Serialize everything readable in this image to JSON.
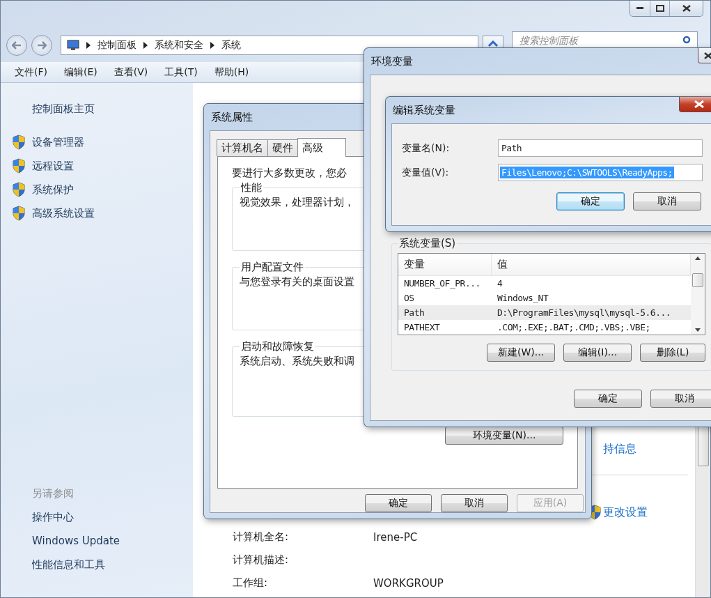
{
  "explorer": {
    "breadcrumb": [
      "控制面板",
      "系统和安全",
      "系统"
    ],
    "search": {
      "placeholder": "搜索控制面板"
    },
    "menu": [
      "文件(F)",
      "编辑(E)",
      "查看(V)",
      "工具(T)",
      "帮助(H)"
    ],
    "sidebar": {
      "home": "控制面板主页",
      "tasks": [
        "设备管理器",
        "远程设置",
        "系统保护",
        "高级系统设置"
      ],
      "see_also_title": "另请参阅",
      "see_also": [
        "操作中心",
        "Windows Update",
        "性能信息和工具"
      ]
    },
    "details": {
      "support_link": "持信息",
      "change_link": "更改设置",
      "rows": [
        {
          "label": "计算机全名:",
          "value": "Irene-PC"
        },
        {
          "label": "计算机描述:",
          "value": ""
        },
        {
          "label": "工作组:",
          "value": "WORKGROUP"
        }
      ]
    }
  },
  "system_properties": {
    "title": "系统属性",
    "tabs": [
      {
        "label": "计算机名",
        "selected": false
      },
      {
        "label": "硬件",
        "selected": false
      },
      {
        "label": "高级",
        "selected": true
      }
    ],
    "intro": "要进行大多数更改，您必",
    "groups": [
      {
        "title": "性能",
        "text": "视觉效果，处理器计划，"
      },
      {
        "title": "用户配置文件",
        "text": "与您登录有关的桌面设置"
      },
      {
        "title": "启动和故障恢复",
        "text": "系统启动、系统失败和调"
      }
    ],
    "env_button": "环境变量(N)...",
    "buttons": [
      {
        "label": "确定",
        "disabled": false
      },
      {
        "label": "取消",
        "disabled": false
      },
      {
        "label": "应用(A)",
        "disabled": true
      }
    ]
  },
  "env_vars": {
    "title": "环境变量",
    "system_group": "系统变量(S)",
    "columns": [
      "变量",
      "值"
    ],
    "rows": [
      {
        "name": "NUMBER_OF_PR...",
        "value": "4",
        "selected": false
      },
      {
        "name": "OS",
        "value": "Windows_NT",
        "selected": false
      },
      {
        "name": "Path",
        "value": "D:\\ProgramFiles\\mysql\\mysql-5.6...",
        "selected": true
      },
      {
        "name": "PATHEXT",
        "value": ".COM;.EXE;.BAT;.CMD;.VBS;.VBE;",
        "selected": false
      }
    ],
    "row_buttons": [
      "新建(W)...",
      "编辑(I)...",
      "删除(L)"
    ],
    "buttons": [
      "确定",
      "取消"
    ]
  },
  "edit_dialog": {
    "title": "编辑系统变量",
    "fields": [
      {
        "label": "变量名(N):",
        "value": "Path",
        "selected": false
      },
      {
        "label": "变量值(V):",
        "value": "Files\\Lenovo;C:\\SWTOOLS\\ReadyApps;",
        "selected": true
      }
    ],
    "buttons": [
      {
        "label": "确定",
        "default": true
      },
      {
        "label": "取消",
        "default": false
      }
    ]
  }
}
